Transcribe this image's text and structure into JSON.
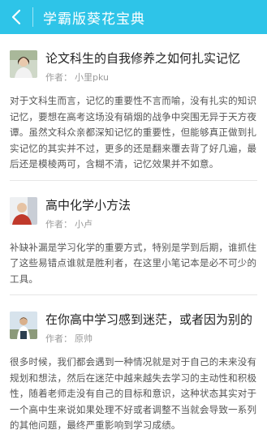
{
  "header": {
    "title": "学霸版葵花宝典",
    "bg_color": "#2ec4e8"
  },
  "author_label": "作者：",
  "articles": [
    {
      "title": "论文科生的自我修养之如何扎实记忆",
      "author": "小里pku",
      "summary": "对于文科生而言，记忆的重要性不言而喻，没有扎实的知识记忆，要想在高考这场没有硝烟的战争中突围无异于天方夜谭。虽然文科众亲都深知记忆的重要性，但能够真正做到扎实记忆的其实并不过，更多的还是翻来覆去背了好几遍，最后还是模棱两可，含糊不清，记忆效果并不如意。"
    },
    {
      "title": "高中化学小方法",
      "author": "小卢",
      "summary": "补缺补漏是学习化学的重要方式，特别是学到后期，谁抓住了这些易错点谁就是胜利者，在这里小笔记本是必不可少的工具。"
    },
    {
      "title": "在你高中学习感到迷茫，或者因为别的",
      "author": "原帅",
      "summary": "很多时候，我们都会遇到一种情况就是对于自己的未来没有规划和想法，然后在迷茫中越来越失去学习的主动性和积极性，随着老师走没有自己的目标和意识，这种状态其实对于一个高中生来说如果处理不好或者调整不当就会导致一系列的其他问题，最终严重影响到学习成绩。"
    }
  ]
}
